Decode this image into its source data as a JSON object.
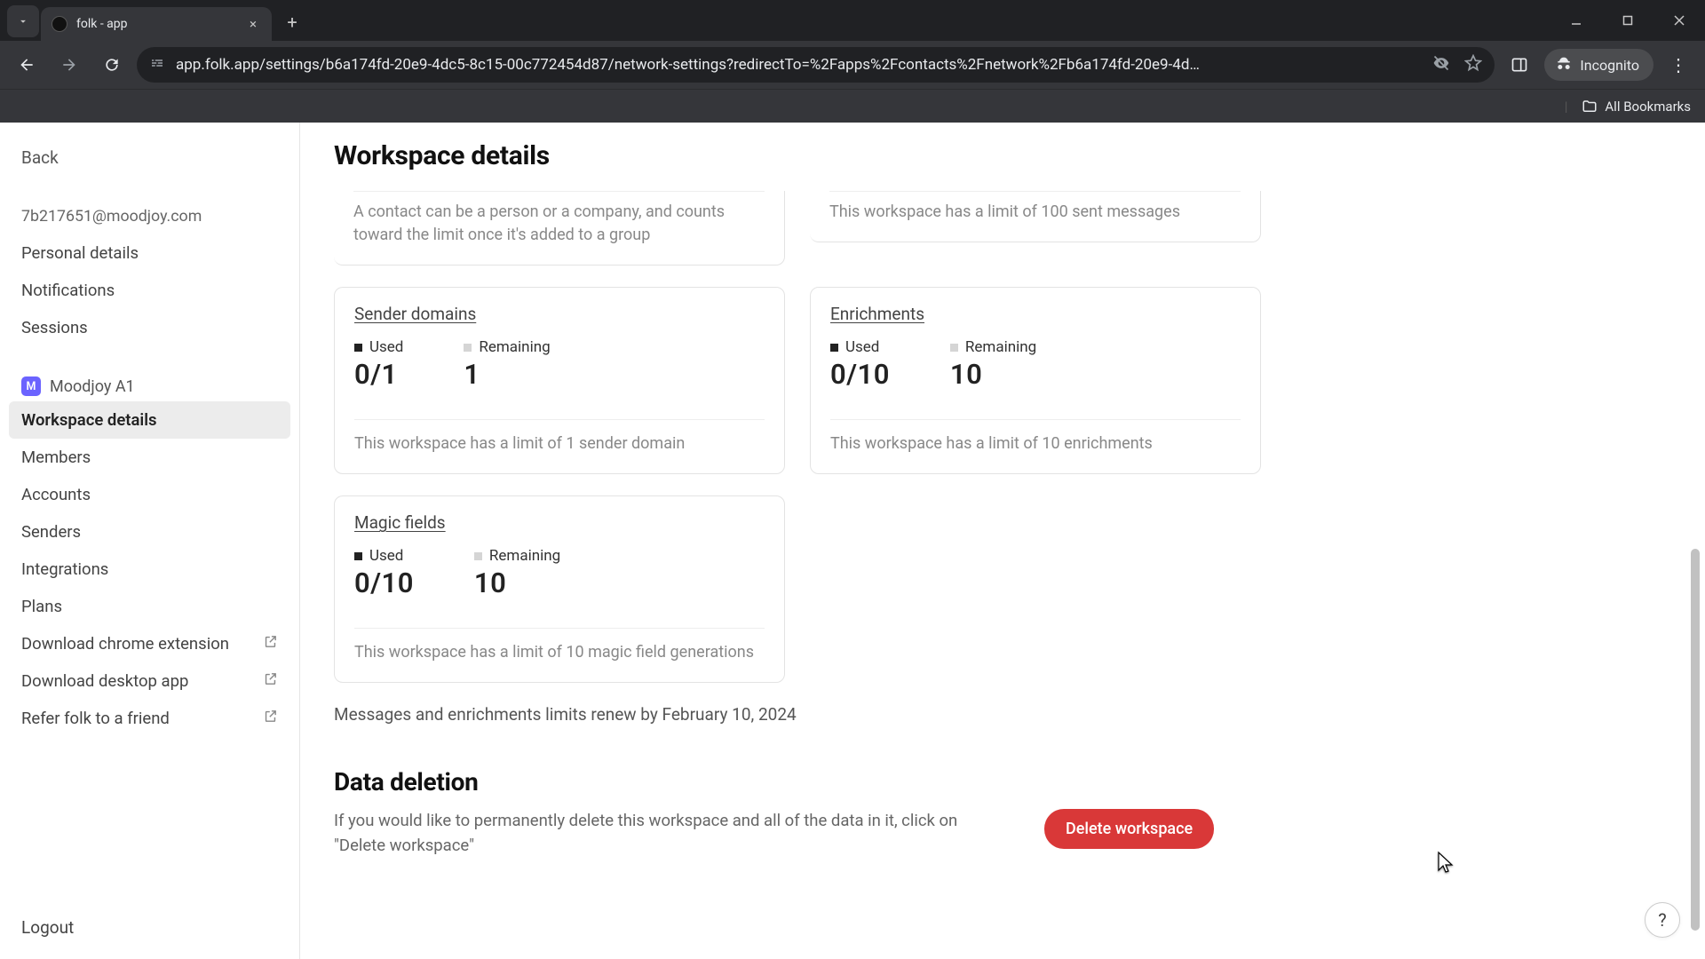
{
  "browser": {
    "tab_title": "folk - app",
    "url": "app.folk.app/settings/b6a174fd-20e9-4dc5-8c15-00c772454d87/network-settings?redirectTo=%2Fapps%2Fcontacts%2Fnetwork%2Fb6a174fd-20e9-4d…",
    "incognito_label": "Incognito",
    "all_bookmarks": "All Bookmarks"
  },
  "sidebar": {
    "back": "Back",
    "email": "7b217651@moodjoy.com",
    "personal": "Personal details",
    "notifications": "Notifications",
    "sessions": "Sessions",
    "workspace_name": "Moodjoy A1",
    "workspace_initial": "M",
    "workspace_details": "Workspace details",
    "members": "Members",
    "accounts": "Accounts",
    "senders": "Senders",
    "integrations": "Integrations",
    "plans": "Plans",
    "chrome_ext": "Download chrome extension",
    "desktop_app": "Download desktop app",
    "refer": "Refer folk to a friend",
    "logout": "Logout"
  },
  "main": {
    "title": "Workspace details",
    "contacts_desc": "A contact can be a person or a company, and counts toward the limit once it's added to a group",
    "messages_desc": "This workspace has a limit of 100 sent messages",
    "used_label": "Used",
    "remaining_label": "Remaining",
    "sender_domains": {
      "title": "Sender domains",
      "used": "0/1",
      "remaining": "1",
      "desc": "This workspace has a limit of 1 sender domain"
    },
    "enrichments": {
      "title": "Enrichments",
      "used": "0/10",
      "remaining": "10",
      "desc": "This workspace has a limit of 10 enrichments"
    },
    "magic_fields": {
      "title": "Magic fields",
      "used": "0/10",
      "remaining": "10",
      "desc": "This workspace has a limit of 10 magic field generations"
    },
    "renew_note": "Messages and enrichments limits renew by February 10, 2024",
    "data_deletion": {
      "title": "Data deletion",
      "text": "If you would like to permanently delete this workspace and all of the data in it, click on \"Delete workspace\"",
      "button": "Delete workspace"
    }
  }
}
